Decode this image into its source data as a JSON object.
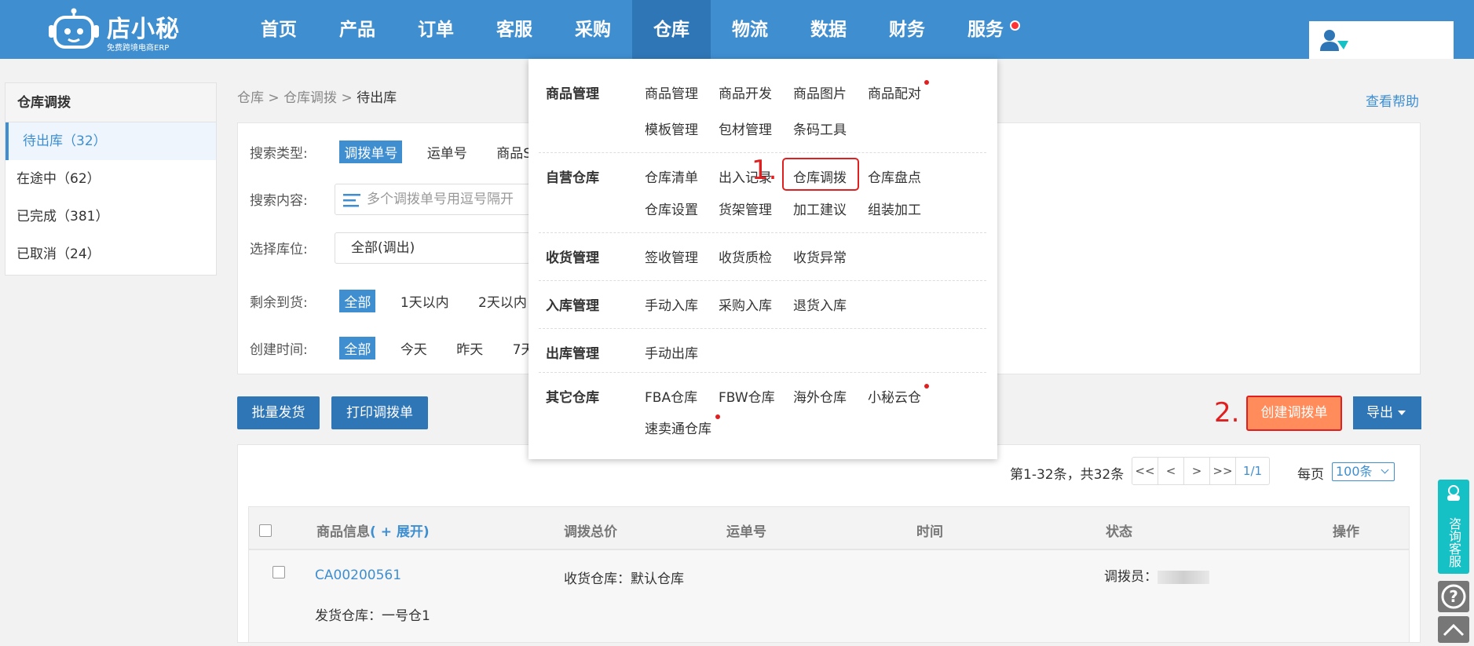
{
  "header": {
    "logo_name": "店小秘",
    "logo_sub": "免费跨境电商ERP",
    "nav": [
      "首页",
      "产品",
      "订单",
      "客服",
      "采购",
      "仓库",
      "物流",
      "数据",
      "财务",
      "服务"
    ]
  },
  "sidebar": {
    "title": "仓库调拨",
    "items": [
      {
        "label": "待出库（32）"
      },
      {
        "label": "在途中（62）"
      },
      {
        "label": "已完成（381）"
      },
      {
        "label": "已取消（24）"
      }
    ]
  },
  "breadcrumb": {
    "a": "仓库",
    "sep1": " > ",
    "b": "仓库调拨",
    "sep2": " > ",
    "cur": "待出库"
  },
  "help": "查看帮助",
  "filters": {
    "search_type_label": "搜索类型:",
    "search_type_options": [
      "调拨单号",
      "运单号",
      "商品S"
    ],
    "search_content_label": "搜索内容:",
    "search_placeholder": "多个调拨单号用逗号隔开",
    "warehouse_label": "选择库位:",
    "warehouse_value": "全部(调出)",
    "remaining_label": "剩余到货:",
    "remaining_options": [
      "全部",
      "1天以内",
      "2天以内"
    ],
    "created_label": "创建时间:",
    "created_options": [
      "全部",
      "今天",
      "昨天",
      "7天"
    ]
  },
  "actions": {
    "batch_ship": "批量发货",
    "print": "打印调拨单",
    "create": "创建调拨单",
    "export": "导出",
    "marker1": "1.",
    "marker2": "2."
  },
  "pager": {
    "summary": "第1-32条，共32条",
    "buttons": [
      "<<",
      "<",
      ">",
      ">>",
      "1/1"
    ],
    "per_page_label": "每页",
    "per_page_value": "100条"
  },
  "table": {
    "headers": {
      "product": "商品信息",
      "expand": "( + 展开)",
      "total": "调拨总价",
      "tracking": "运单号",
      "time": "时间",
      "status": "状态",
      "ops": "操作"
    },
    "rows": [
      {
        "id": "CA00200561",
        "receive": "收货仓库：默认仓库",
        "ship": "发货仓库：一号仓1",
        "operator_label": "调拨员："
      }
    ]
  },
  "dropdown": {
    "groups": [
      {
        "title": "商品管理",
        "items": [
          "商品管理",
          "商品开发",
          "商品图片",
          "商品配对",
          "模板管理",
          "包材管理",
          "条码工具"
        ]
      },
      {
        "title": "自营仓库",
        "items": [
          "仓库清单",
          "出入记录",
          "仓库调拨",
          "仓库盘点",
          "仓库设置",
          "货架管理",
          "加工建议",
          "组装加工"
        ]
      },
      {
        "title": "收货管理",
        "items": [
          "签收管理",
          "收货质检",
          "收货异常"
        ]
      },
      {
        "title": "入库管理",
        "items": [
          "手动入库",
          "采购入库",
          "退货入库"
        ]
      },
      {
        "title": "出库管理",
        "items": [
          "手动出库"
        ]
      },
      {
        "title": "其它仓库",
        "items": [
          "FBA仓库",
          "FBW仓库",
          "海外仓库",
          "小秘云仓",
          "速卖通仓库"
        ]
      }
    ]
  },
  "float_service": "咨询客服",
  "colors": {
    "primary": "#3e8ed0",
    "nav_active": "#2f76b7",
    "accent": "#ff8c5a",
    "alert": "#e02020",
    "service": "#16c1c6"
  }
}
